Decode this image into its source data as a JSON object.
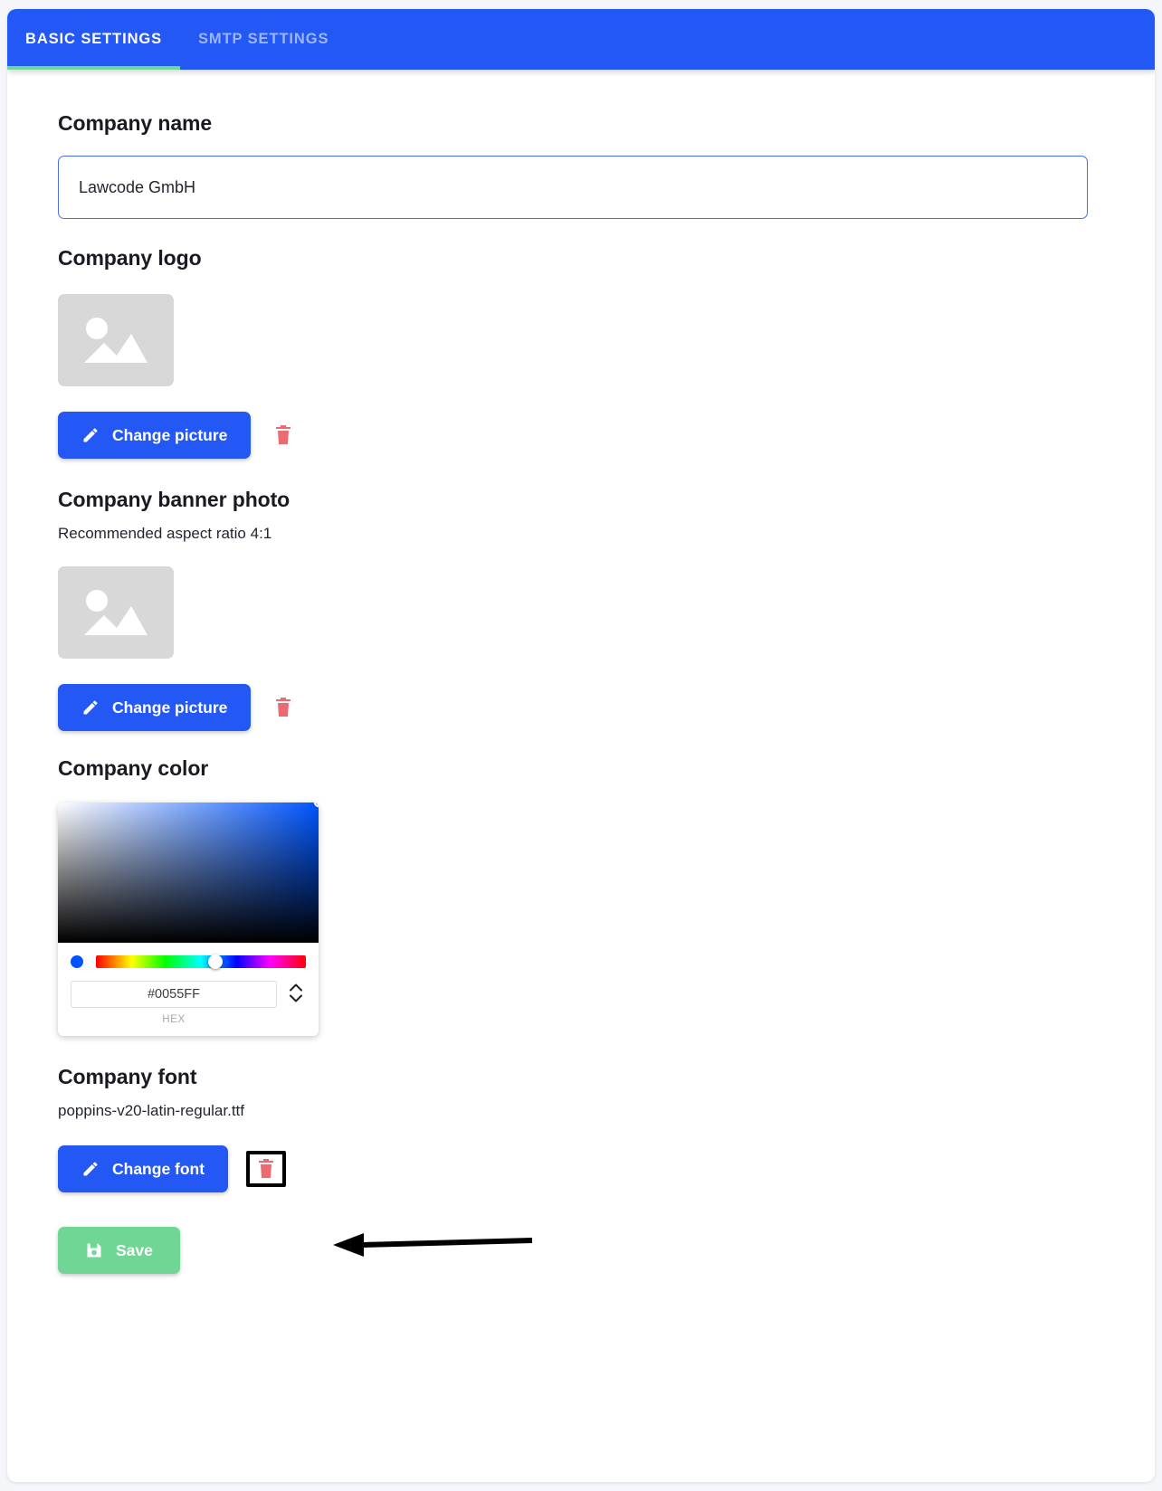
{
  "tabs": [
    {
      "label": "BASIC SETTINGS",
      "active": true
    },
    {
      "label": "SMTP SETTINGS",
      "active": false
    }
  ],
  "sections": {
    "company_name": {
      "title": "Company name",
      "value": "Lawcode GmbH",
      "placeholder": "Company name"
    },
    "company_logo": {
      "title": "Company logo",
      "change_label": "Change picture",
      "delete_icon": "trash-icon",
      "placeholder_icon": "image-placeholder-icon"
    },
    "company_banner": {
      "title": "Company banner photo",
      "hint": "Recommended aspect ratio 4:1",
      "change_label": "Change picture",
      "delete_icon": "trash-icon",
      "placeholder_icon": "image-placeholder-icon"
    },
    "company_color": {
      "title": "Company color",
      "hex_value": "#0055FF",
      "hex_label": "HEX",
      "selected_color": "#0055FF",
      "stepper_icons": [
        "chevron-up-icon",
        "chevron-down-icon"
      ]
    },
    "company_font": {
      "title": "Company font",
      "filename": "poppins-v20-latin-regular.ttf",
      "change_label": "Change font",
      "delete_icon": "trash-icon"
    }
  },
  "save": {
    "label": "Save",
    "icon": "save-floppy-icon"
  },
  "colors": {
    "brand_blue": "#2458F5",
    "tab_inactive": "#9CB5FB",
    "tab_underline_green": "#6FD696",
    "save_green": "#6FD696",
    "trash_red": "#EE6A71",
    "page_bg": "#F4F6FA",
    "placeholder_gray": "#D8D8D8",
    "annotation_black": "#000000"
  },
  "annotation": {
    "type": "arrow-pointing-left",
    "target": "delete-font-button"
  }
}
